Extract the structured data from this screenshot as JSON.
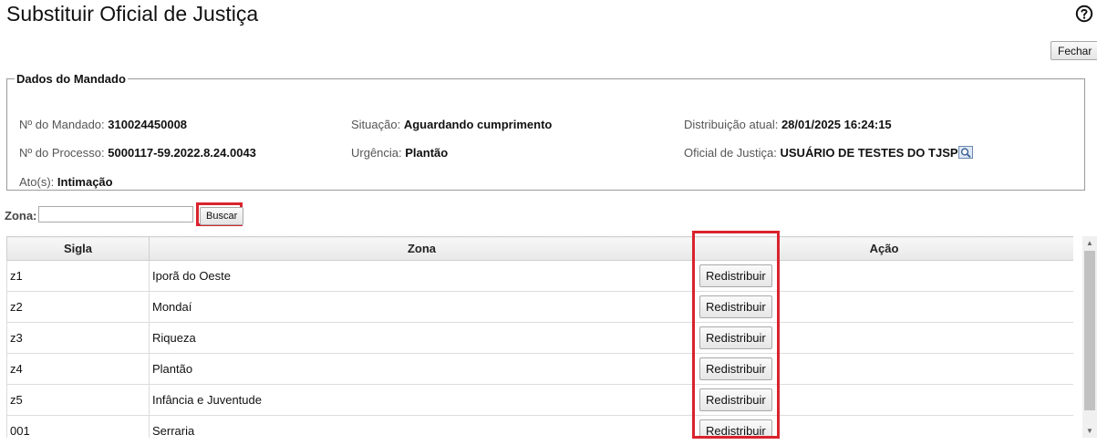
{
  "page": {
    "title": "Substituir Oficial de Justiça"
  },
  "header": {
    "close_label": "Fechar"
  },
  "warrant": {
    "legend": "Dados do Mandado",
    "warrant_number": {
      "label": "Nº do Mandado:",
      "value": "310024450008"
    },
    "status": {
      "label": "Situação:",
      "value": "Aguardando cumprimento"
    },
    "current_distribution": {
      "label": "Distribuição atual:",
      "value": "28/01/2025 16:24:15"
    },
    "process_number": {
      "label": "Nº do Processo:",
      "value": "5000117-59.2022.8.24.0043"
    },
    "urgency": {
      "label": "Urgência:",
      "value": "Plantão"
    },
    "officer": {
      "label": "Oficial de Justiça:",
      "value": "USUÁRIO DE TESTES DO TJSP"
    },
    "acts": {
      "label": "Ato(s):",
      "value": "Intimação"
    }
  },
  "search": {
    "label": "Zona:",
    "value": "",
    "button_label": "Buscar"
  },
  "table": {
    "headers": {
      "sigla": "Sigla",
      "zona": "Zona",
      "acao": "Ação"
    },
    "rows": [
      {
        "sigla": "z1",
        "zona": "Iporã do Oeste",
        "action": "Redistribuir"
      },
      {
        "sigla": "z2",
        "zona": "Mondaí",
        "action": "Redistribuir"
      },
      {
        "sigla": "z3",
        "zona": "Riqueza",
        "action": "Redistribuir"
      },
      {
        "sigla": "z4",
        "zona": "Plantão",
        "action": "Redistribuir"
      },
      {
        "sigla": "z5",
        "zona": "Infância e Juventude",
        "action": "Redistribuir"
      },
      {
        "sigla": "001",
        "zona": "Serraria",
        "action": "Redistribuir"
      }
    ]
  },
  "icons": {
    "help": "help-circle-icon",
    "officer_lookup": "magnifier-icon"
  },
  "colors": {
    "highlight": "#d9232e"
  }
}
